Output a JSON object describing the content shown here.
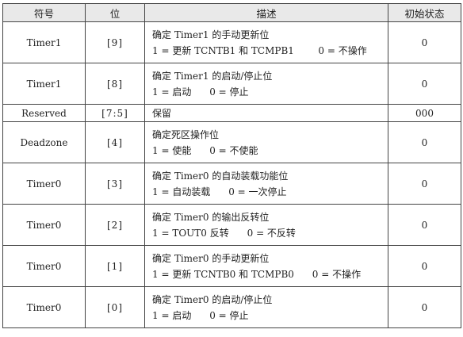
{
  "headers": {
    "symbol": "符号",
    "bit": "位",
    "description": "描述",
    "initial_state": "初始状态"
  },
  "rows": [
    {
      "symbol": "Timer1",
      "bit": "[9]",
      "desc_line1": "确定 Timer1 的手动更新位",
      "desc_line2": "1 = 更新 TCNTB1 和 TCMPB1        0 = 不操作",
      "initial": "0"
    },
    {
      "symbol": "Timer1",
      "bit": "[8]",
      "desc_line1": "确定 Timer1 的启动/停止位",
      "desc_line2": "1 = 启动      0 = 停止",
      "initial": "0"
    },
    {
      "symbol": "Reserved",
      "bit": "[7:5]",
      "desc_line1": "保留",
      "desc_line2": "",
      "initial": "000"
    },
    {
      "symbol": "Deadzone",
      "bit": "[4]",
      "desc_line1": "确定死区操作位",
      "desc_line2": "1 = 使能      0 = 不使能",
      "initial": "0"
    },
    {
      "symbol": "Timer0",
      "bit": "[3]",
      "desc_line1": "确定 Timer0 的自动装载功能位",
      "desc_line2": "1 = 自动装载      0 = 一次停止",
      "initial": "0"
    },
    {
      "symbol": "Timer0",
      "bit": "[2]",
      "desc_line1": "确定 Timer0 的输出反转位",
      "desc_line2": "1 = TOUT0 反转      0 = 不反转",
      "initial": "0"
    },
    {
      "symbol": "Timer0",
      "bit": "[1]",
      "desc_line1": "确定 Timer0 的手动更新位",
      "desc_line2": "1 = 更新 TCNTB0 和 TCMPB0      0 = 不操作",
      "initial": "0"
    },
    {
      "symbol": "Timer0",
      "bit": "[0]",
      "desc_line1": "确定 Timer0 的启动/停止位",
      "desc_line2": "1 = 启动      0 = 停止",
      "initial": "0"
    }
  ]
}
